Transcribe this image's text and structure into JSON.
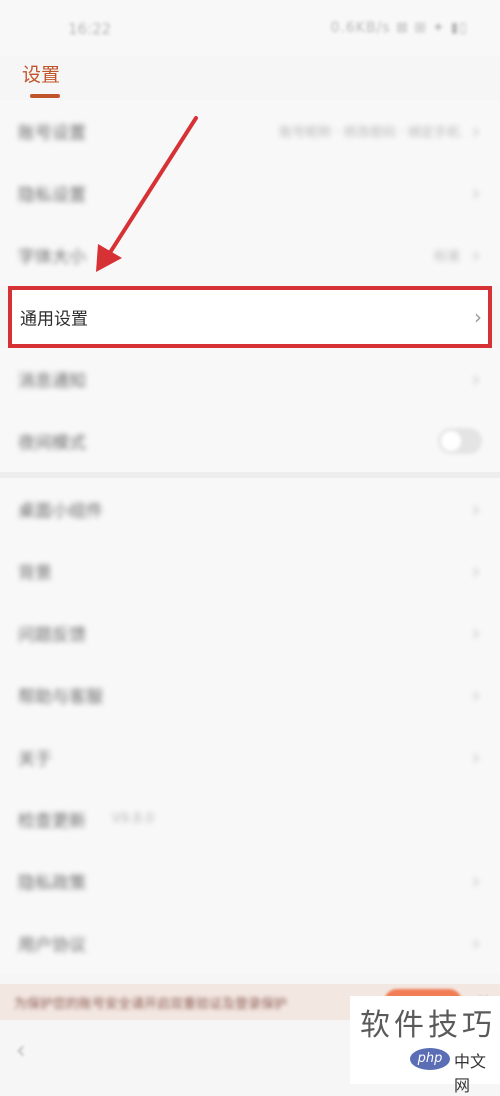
{
  "status_bar": {
    "time": "16:22",
    "indicators": "0.6KB/s ⊠ ⊞ ✦ ▮▯"
  },
  "page": {
    "title": "设置"
  },
  "rows": [
    {
      "label": "账号设置",
      "value": "账号昵称 · 修改密码 · 绑定手机",
      "chevron": "›"
    },
    {
      "label": "隐私设置",
      "chevron": "›"
    },
    {
      "label": "字体大小",
      "value": "标准",
      "chevron": "›"
    },
    {
      "label": "通用设置",
      "chevron": "›"
    },
    {
      "label": "消息通知",
      "chevron": "›"
    },
    {
      "label": "夜间模式",
      "toggle": "off"
    },
    {
      "label": "桌面小组件",
      "chevron": "›"
    },
    {
      "label": "背景",
      "chevron": "›"
    },
    {
      "label": "问题反馈",
      "chevron": "›"
    },
    {
      "label": "帮助与客服",
      "chevron": "›"
    },
    {
      "label": "关于",
      "chevron": "›"
    },
    {
      "label": "检查更新",
      "value": "V9.8.0"
    },
    {
      "label": "隐私政策",
      "chevron": "›"
    },
    {
      "label": "用户协议",
      "chevron": "›"
    }
  ],
  "banner": {
    "text": "为保护您的账号安全请开启双重验证及登录保护",
    "close": "×"
  },
  "bottom": {
    "back": "‹"
  },
  "watermark": {
    "title": "软件技巧",
    "php": "php",
    "site": "中文网"
  },
  "colors": {
    "accent": "#c0542a",
    "highlight": "#d63236"
  }
}
